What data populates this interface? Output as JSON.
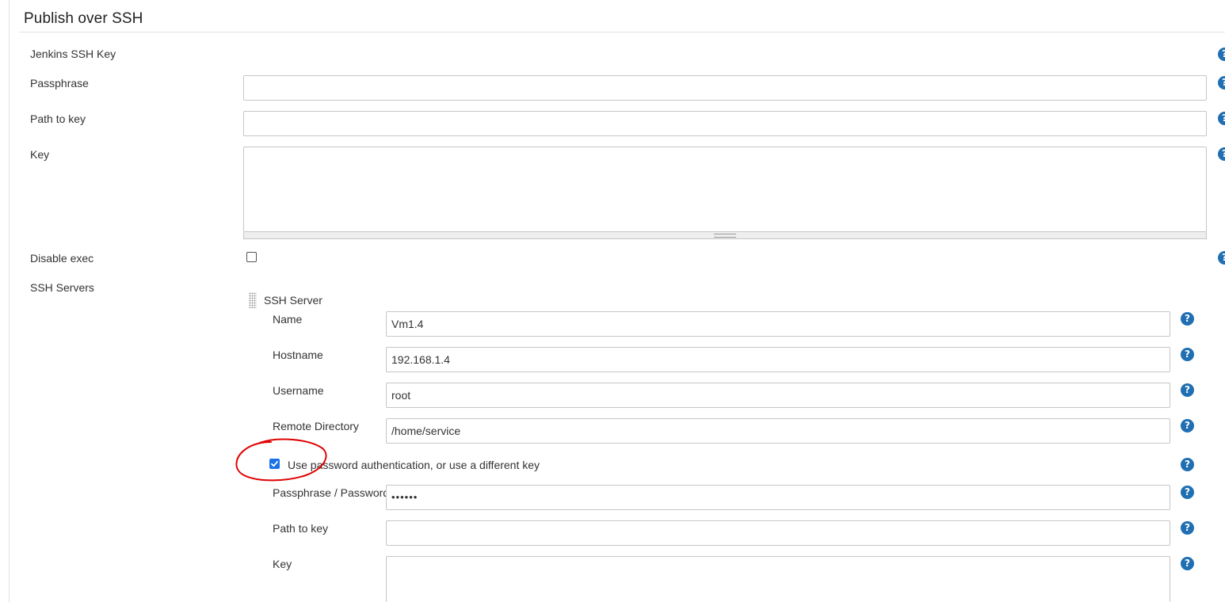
{
  "section": {
    "title": "Publish over SSH"
  },
  "jenkins_key": {
    "jenkins_ssh_key_label": "Jenkins SSH Key",
    "passphrase_label": "Passphrase",
    "passphrase_value": "",
    "path_to_key_label": "Path to key",
    "path_to_key_value": "",
    "key_label": "Key",
    "key_value": "",
    "disable_exec_label": "Disable exec",
    "disable_exec_checked": false
  },
  "ssh_servers": {
    "label": "SSH Servers",
    "server": {
      "header": "SSH Server",
      "name_label": "Name",
      "name_value": "Vm1.4",
      "hostname_label": "Hostname",
      "hostname_value": "192.168.1.4",
      "username_label": "Username",
      "username_value": "root",
      "remote_directory_label": "Remote Directory",
      "remote_directory_value": "/home/service",
      "use_password_label": "Use password authentication, or use a different key",
      "use_password_checked": true,
      "passphrase_password_label": "Passphrase / Password",
      "passphrase_password_value": "••••••",
      "path_to_key_label": "Path to key",
      "path_to_key_value": "",
      "key_label": "Key",
      "key_value": ""
    }
  },
  "help_icon_glyph": "?",
  "colors": {
    "help_icon": "#1f6fb2",
    "checkbox_accent": "#1a73e8",
    "annotation_circle": "#e00000"
  }
}
